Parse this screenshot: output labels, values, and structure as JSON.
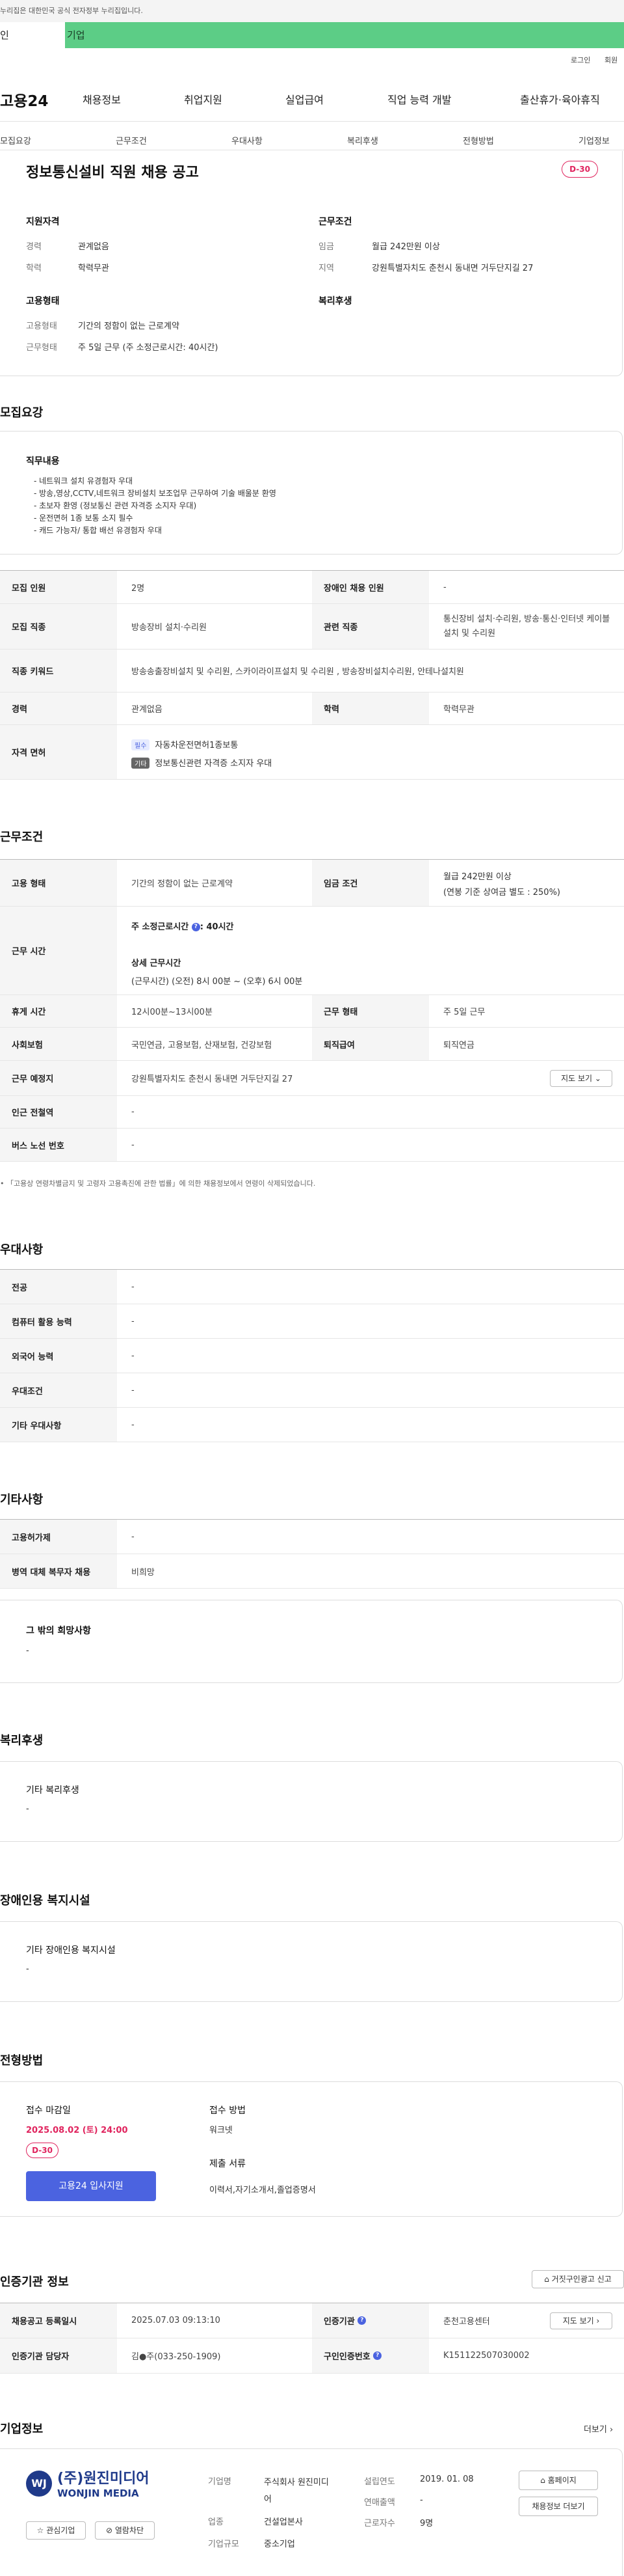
{
  "topbar": {
    "notice": "누리집은 대한민국 공식 전자정부 누리집입니다."
  },
  "tabs": {
    "personal": "인",
    "company": "기업"
  },
  "util": {
    "login": "로그인",
    "join": "회원"
  },
  "logo": "고용24",
  "gnb": [
    "채용정보",
    "취업지원",
    "실업급여",
    "직업 능력 개발",
    "출산휴가·육아휴직"
  ],
  "subnav": [
    "모집요강",
    "근무조건",
    "우대사항",
    "복리후생",
    "전형방법",
    "기업정보"
  ],
  "header": {
    "title": "정보통신설비 직원 채용 공고",
    "dday": "D-30"
  },
  "summary": {
    "qual_title": "지원자격",
    "career_label": "경력",
    "career": "관계없음",
    "edu_label": "학력",
    "edu": "학력무관",
    "cond_title": "근무조건",
    "wage_label": "임금",
    "wage": "월급 242만원 이상",
    "region_label": "지역",
    "region": "강원특별자치도 춘천시 동내면 거두단지길 27",
    "emp_title": "고용형태",
    "emptype_label": "고용형태",
    "emptype": "기간의 정함이 없는 근로계약",
    "hours_label": "근무형태",
    "hours": "주 5일 근무 (주 소정근로시간: 40시간)",
    "welfare_title": "복리후생"
  },
  "recruit": {
    "title": "모집요강",
    "duty_title": "직무내용",
    "duty_lines": [
      "- 네트워크 설치 유경험자 우대",
      "- 방송,영상,CCTV,네트워크 장비설치 보조업무    근무하여 기술 배울분 환영",
      "- 초보자 환영   (정보통신 관련 자격증 소지자 우대)",
      "- 운전면허 1종 보통 소지 필수",
      "- 캐드 가능자/ 통합 배선 유경험자 우대"
    ],
    "count_label": "모집 인원",
    "count": "2명",
    "disabled_label": "장애인 채용 인원",
    "disabled": "-",
    "job_label": "모집 직종",
    "job": "방송장비 설치·수리원",
    "related_label": "관련 직종",
    "related": "통신장비 설치·수리원, 방송·통신·인터넷 케이블 설치 및 수리원",
    "kw_label": "직종 키워드",
    "kw": "방송송출장비설치 및 수리원, 스카이라이프설치 및 수리원 , 방송장비설치수리원, 안테나설치원",
    "career_label": "경력",
    "career": "관계없음",
    "edu_label": "학력",
    "edu": "학력무관",
    "license_label": "자격 면허",
    "lic1_badge": "필수",
    "lic1": "자동차운전면허1종보통",
    "lic2_badge": "기타",
    "lic2": "정보통신관련 자격증 소지자 우대"
  },
  "work": {
    "title": "근무조건",
    "type_label": "고용 형태",
    "type": "기간의 정함이 없는 근로계약",
    "wage_label": "임금 조건",
    "wage1": "월급 242만원 이상",
    "wage2": "(연봉 기준 상여금 별도 : 250%)",
    "time_label": "근무 시간",
    "week_hours": "주 소정근로시간",
    "week_hours_val": ": 40시간",
    "detail_title": "상세 근무시간",
    "detail": "(근무시간) (오전) 8시 00분 ~ (오후) 6시 00분",
    "rest_label": "휴게 시간",
    "rest": "12시00분~13시00분",
    "form_label": "근무 형태",
    "form": "주 5일 근무",
    "ins_label": "사회보험",
    "ins": "국민연금, 고용보험, 산재보험, 건강보험",
    "sev_label": "퇴직급여",
    "sev": "퇴직연금",
    "place_label": "근무 예정지",
    "place": "강원특별자치도 춘천시 동내면 거두단지길 27",
    "map_btn": "지도 보기",
    "subway_label": "인근 전철역",
    "subway": "-",
    "bus_label": "버스 노선 번호",
    "bus": "-",
    "notice": "「고용상 연령차별금지 및 고령자 고용촉진에 관한 법률」에 의한 채용정보에서 연령이 삭제되었습니다."
  },
  "pref": {
    "title": "우대사항",
    "rows": [
      {
        "k": "전공",
        "v": "-"
      },
      {
        "k": "컴퓨터 활용 능력",
        "v": "-"
      },
      {
        "k": "외국어 능력",
        "v": "-"
      },
      {
        "k": "우대조건",
        "v": "-"
      },
      {
        "k": "기타 우대사항",
        "v": "-"
      }
    ]
  },
  "etc": {
    "title": "기타사항",
    "rows": [
      {
        "k": "고용허가제",
        "v": "-"
      },
      {
        "k": "병역 대체 복무자 채용",
        "v": "비희망"
      }
    ],
    "hope_title": "그 밖의 희망사항",
    "hope": "-"
  },
  "welfare": {
    "title": "복리후생",
    "sub": "기타 복리후생",
    "val": "-"
  },
  "disab": {
    "title": "장애인용 복지시설",
    "sub": "기타 장애인용 복지시설",
    "val": "-"
  },
  "process": {
    "title": "전형방법",
    "deadline_label": "접수 마감일",
    "deadline": "2025.08.02 (토) 24:00",
    "dday": "D-30",
    "apply_btn": "고용24 입사지원",
    "method_label": "접수 방법",
    "method": "워크넷",
    "docs_label": "제출 서류",
    "docs": "이력서,자기소개서,졸업증명서"
  },
  "agency": {
    "title": "인증기관 정보",
    "report_btn": "거짓구인광고 신고",
    "reg_label": "채용공고 등록일시",
    "reg": "2025.07.03 09:13:10",
    "org_label": "인증기관",
    "org": "춘천고용센터",
    "map_btn": "지도 보기",
    "mgr_label": "인증기관 담당자",
    "mgr": "김●주(033-250-1909)",
    "no_label": "구인인증번호",
    "no": "K151122507030002"
  },
  "company": {
    "title": "기업정보",
    "more": "더보기",
    "logo_ko": "(주)원진미디어",
    "logo_en": "WONJIN MEDIA",
    "fav_btn": "관심기업",
    "block_btn": "열람차단",
    "name_label": "기업명",
    "name": "주식회사 원진미디어",
    "ind_label": "업종",
    "ind": "건설업본사",
    "size_label": "기업규모",
    "size": "중소기업",
    "est_label": "설립연도",
    "est": "2019. 01. 08",
    "sales_label": "연매출액",
    "sales": "-",
    "emp_label": "근로자수",
    "emp": "9명",
    "home_btn": "홈페이지",
    "more_btn": "채용정보 더보기"
  }
}
